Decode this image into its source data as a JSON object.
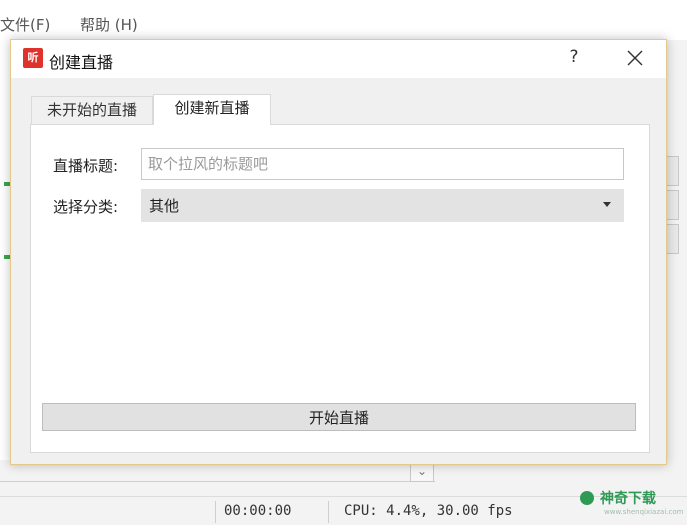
{
  "app": {
    "menu": [
      {
        "label": "文件(F)"
      },
      {
        "label": "帮助 (H)"
      }
    ]
  },
  "dialog": {
    "icon_text": "听",
    "title": "创建直播",
    "help": "?",
    "tabs": [
      {
        "label": "未开始的直播",
        "active": false
      },
      {
        "label": "创建新直播",
        "active": true
      }
    ],
    "form": {
      "title_label": "直播标题:",
      "title_value": "",
      "title_placeholder": "取个拉风的标题吧",
      "category_label": "选择分类:",
      "category_value": "其他"
    },
    "start_button": "开始直播"
  },
  "statusbar": {
    "time": "00:00:00",
    "stats": "CPU: 4.4%, 30.00 fps"
  },
  "watermark": {
    "text": "神奇下载",
    "url": "www.shenqixiazai.com"
  },
  "colors": {
    "accent_green": "#2f9a56",
    "app_icon_red": "#e0322c",
    "dialog_border": "#e3c98a"
  }
}
